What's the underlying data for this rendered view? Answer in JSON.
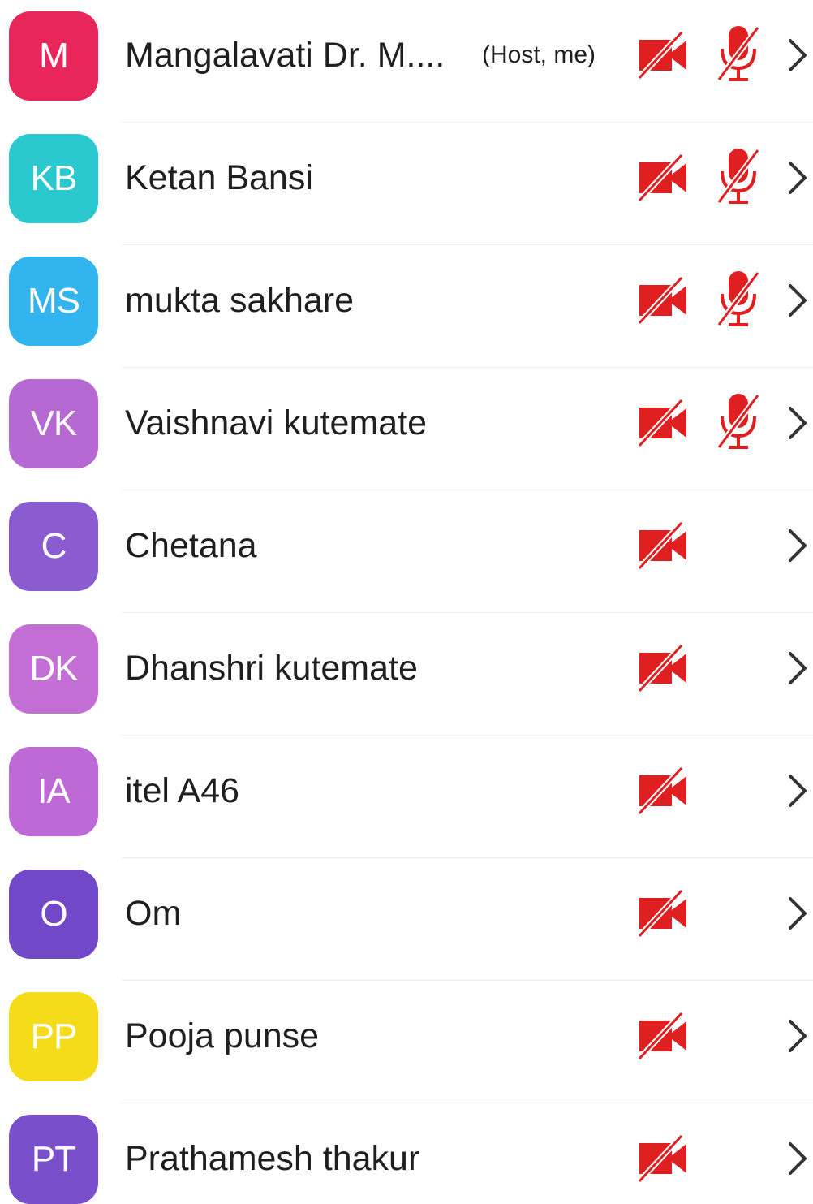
{
  "colors": {
    "muted_red": "#e02020",
    "chevron": "#333333",
    "text": "#1f1f1f"
  },
  "participants": [
    {
      "initials": "M",
      "name": "Mangalavati Dr. M....",
      "role": "(Host, me)",
      "avatar_color": "#e8265a",
      "video_off": true,
      "audio_muted": true
    },
    {
      "initials": "KB",
      "name": "Ketan Bansi",
      "role": "",
      "avatar_color": "#2cc8cf",
      "video_off": true,
      "audio_muted": true
    },
    {
      "initials": "MS",
      "name": "mukta sakhare",
      "role": "",
      "avatar_color": "#32b4ee",
      "video_off": true,
      "audio_muted": true
    },
    {
      "initials": "VK",
      "name": "Vaishnavi kutemate",
      "role": "",
      "avatar_color": "#b769d3",
      "video_off": true,
      "audio_muted": true
    },
    {
      "initials": "C",
      "name": "Chetana",
      "role": "",
      "avatar_color": "#8a5ccf",
      "video_off": true,
      "audio_muted": false
    },
    {
      "initials": "DK",
      "name": "Dhanshri kutemate",
      "role": "",
      "avatar_color": "#c46fd6",
      "video_off": true,
      "audio_muted": false
    },
    {
      "initials": "IA",
      "name": "itel A46",
      "role": "",
      "avatar_color": "#be6ad6",
      "video_off": true,
      "audio_muted": false
    },
    {
      "initials": "O",
      "name": "Om",
      "role": "",
      "avatar_color": "#7048c8",
      "video_off": true,
      "audio_muted": false
    },
    {
      "initials": "PP",
      "name": "Pooja punse",
      "role": "",
      "avatar_color": "#f5dc1a",
      "video_off": true,
      "audio_muted": false
    },
    {
      "initials": "PT",
      "name": "Prathamesh thakur",
      "role": "",
      "avatar_color": "#7a4fcc",
      "video_off": true,
      "audio_muted": false
    }
  ],
  "icons": {
    "camera": "video-off-icon",
    "mic": "mic-off-icon",
    "chevron": "chevron-right-icon"
  }
}
